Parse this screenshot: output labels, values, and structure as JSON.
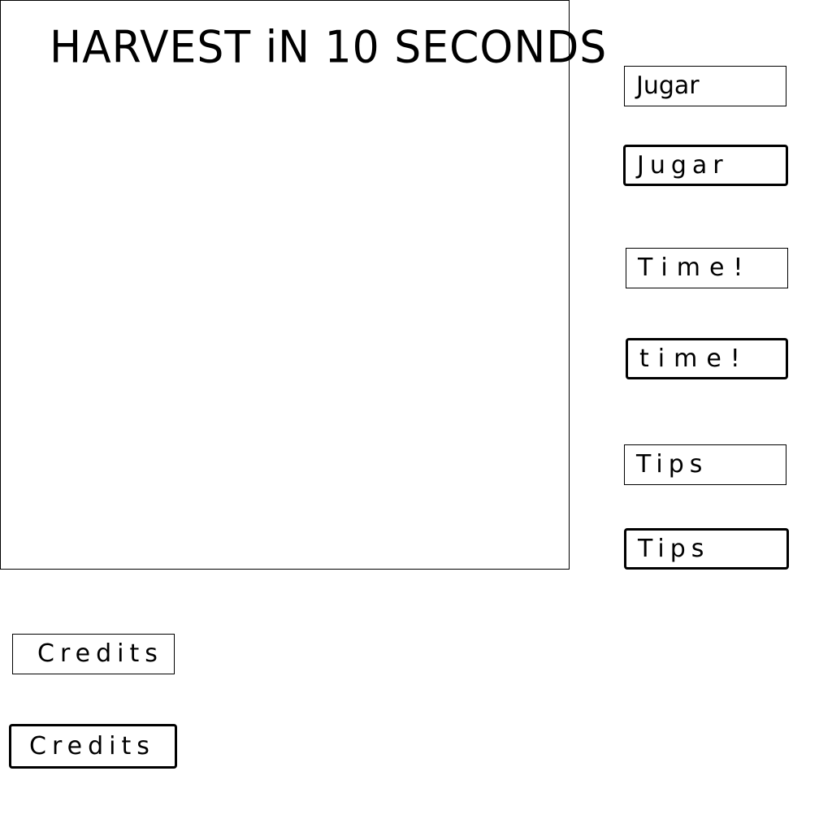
{
  "game": {
    "title": "HARVEST iN 10 SECONDS"
  },
  "buttons": {
    "sugar": {
      "normal_label": "Jugar",
      "pressed_label": "Jugar"
    },
    "time": {
      "normal_label": "Time!",
      "pressed_label": "time!"
    },
    "tips": {
      "normal_label": "Tips",
      "pressed_label": "Tips"
    },
    "credits": {
      "normal_label": "Credits",
      "pressed_label": "Credits"
    }
  }
}
